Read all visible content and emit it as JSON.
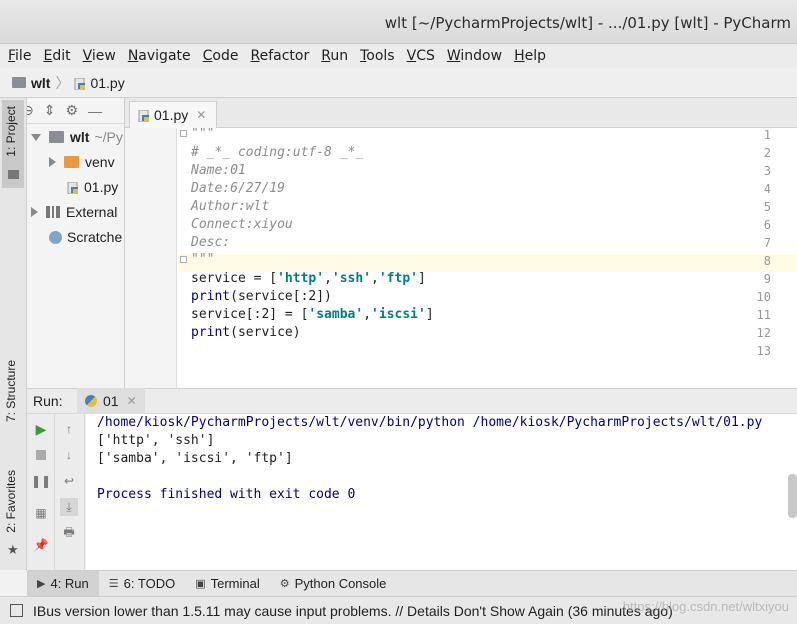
{
  "window": {
    "title": "wlt [~/PycharmProjects/wlt] - .../01.py [wlt] - PyCharm"
  },
  "menu": [
    "File",
    "Edit",
    "View",
    "Navigate",
    "Code",
    "Refactor",
    "Run",
    "Tools",
    "VCS",
    "Window",
    "Help"
  ],
  "breadcrumb": {
    "project": "wlt",
    "file": "01.py"
  },
  "sidebar_left": {
    "project_tab": "1: Project",
    "structure_tab": "7: Structure",
    "favorites_tab": "2: Favorites"
  },
  "project_tree": {
    "root": "wlt",
    "root_path": "~/Py",
    "venv": "venv",
    "file": "01.py",
    "external": "External",
    "scratches": "Scratche"
  },
  "editor": {
    "tab_label": "01.py",
    "lines": [
      {
        "n": "1",
        "text": "\"\"\""
      },
      {
        "n": "2",
        "text": "# _*_ coding:utf-8 _*_"
      },
      {
        "n": "3",
        "text": "Name:01"
      },
      {
        "n": "4",
        "text": "Date:6/27/19"
      },
      {
        "n": "5",
        "text": "Author:wlt"
      },
      {
        "n": "6",
        "text": "Connect:xiyou"
      },
      {
        "n": "7",
        "text": "Desc:"
      },
      {
        "n": "8",
        "text": "\"\"\""
      },
      {
        "n": "9",
        "text": "service = ['http','ssh','ftp']"
      },
      {
        "n": "10",
        "text": "print(service[:2])"
      },
      {
        "n": "11",
        "text": "service[:2] = ['samba','iscsi']"
      },
      {
        "n": "12",
        "text": "print(service)"
      },
      {
        "n": "13",
        "text": ""
      }
    ]
  },
  "run": {
    "label": "Run:",
    "tab": "01",
    "output": [
      "/home/kiosk/PycharmProjects/wlt/venv/bin/python /home/kiosk/PycharmProjects/wlt/01.py",
      "['http', 'ssh']",
      "['samba', 'iscsi', 'ftp']",
      "",
      "Process finished with exit code 0"
    ]
  },
  "bottom_tabs": [
    "4: Run",
    "6: TODO",
    "Terminal",
    "Python Console"
  ],
  "status": {
    "message": "IBus version lower than 1.5.11 may cause input problems. // Details Don't Show Again (36 minutes ago)"
  },
  "watermark": "https://blog.csdn.net/wltxiyou",
  "colors": {
    "keyword": "#000080",
    "string": "#008080",
    "comment": "#8c8c8c",
    "caret_line": "#fffae3"
  }
}
